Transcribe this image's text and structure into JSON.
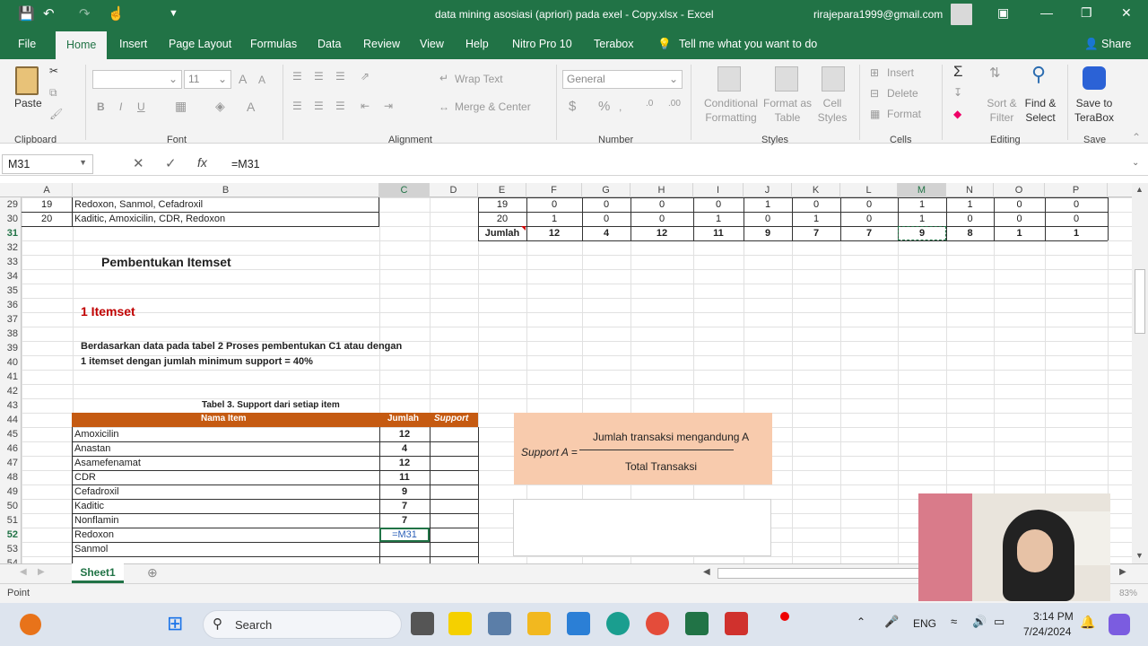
{
  "title_bar": {
    "document_title": "data mining asosiasi (apriori) pada exel - Copy.xlsx  -  Excel",
    "user_email": "rirajepara1999@gmail.com"
  },
  "ribbon_tabs": [
    "File",
    "Home",
    "Insert",
    "Page Layout",
    "Formulas",
    "Data",
    "Review",
    "View",
    "Help",
    "Nitro Pro 10",
    "Terabox"
  ],
  "tell_me": "Tell me what you want to do",
  "share": "Share",
  "ribbon": {
    "paste": "Paste",
    "clipboard": "Clipboard",
    "font_size": "11",
    "font": "Font",
    "wrap_text": "Wrap Text",
    "merge_center": "Merge & Center",
    "alignment": "Alignment",
    "number_format": "General",
    "number": "Number",
    "conditional_formatting": "Conditional Formatting",
    "format_as_table": "Format as Table",
    "cell_styles": "Cell Styles",
    "styles": "Styles",
    "insert": "Insert",
    "delete": "Delete",
    "format": "Format",
    "cells": "Cells",
    "sort_filter": "Sort & Filter",
    "find_select": "Find & Select",
    "editing": "Editing",
    "save_terabox": "Save to TeraBox",
    "save": "Save"
  },
  "formula_bar": {
    "name_box": "M31",
    "formula": "=M31"
  },
  "columns": [
    "A",
    "B",
    "C",
    "D",
    "E",
    "F",
    "G",
    "H",
    "I",
    "J",
    "K",
    "L",
    "M",
    "N",
    "O",
    "P"
  ],
  "rows": [
    "29",
    "30",
    "31",
    "32",
    "33",
    "34",
    "35",
    "36",
    "37",
    "38",
    "39",
    "40",
    "41",
    "42",
    "43",
    "44",
    "45",
    "46",
    "47",
    "48",
    "49",
    "50",
    "51",
    "52",
    "53",
    "54"
  ],
  "data_rows": [
    {
      "a": "19",
      "b": "Redoxon, Sanmol, Cefadroxil"
    },
    {
      "a": "20",
      "b": "Kaditic, Amoxicilin, CDR, Redoxon"
    }
  ],
  "right_table": {
    "row29": [
      "19",
      "0",
      "0",
      "0",
      "0",
      "1",
      "0",
      "0",
      "1",
      "1",
      "0",
      "0"
    ],
    "row30": [
      "20",
      "1",
      "0",
      "0",
      "1",
      "0",
      "1",
      "0",
      "1",
      "0",
      "0",
      "0"
    ],
    "row31": [
      "Jumlah",
      "12",
      "4",
      "12",
      "11",
      "9",
      "7",
      "7",
      "9",
      "8",
      "1",
      "1"
    ]
  },
  "heading_itemset": "Pembentukan Itemset",
  "heading_1itemset": "1 Itemset",
  "para_line1": "Berdasarkan data pada tabel 2 Proses pembentukan C1 atau dengan",
  "para_line2": "1 itemset dengan jumlah minimum support = 40%",
  "table3": {
    "caption": "Tabel 3. Support dari setiap item",
    "headers": [
      "Nama Item",
      "Jumlah",
      "Support"
    ],
    "rows": [
      {
        "name": "Amoxicilin",
        "count": "12"
      },
      {
        "name": "Anastan",
        "count": "4"
      },
      {
        "name": "Asamefenamat",
        "count": "12"
      },
      {
        "name": "CDR",
        "count": "11"
      },
      {
        "name": "Cefadroxil",
        "count": "9"
      },
      {
        "name": "Kaditic",
        "count": "7"
      },
      {
        "name": "Nonflamin",
        "count": "7"
      },
      {
        "name": "Redoxon",
        "count": "=M31"
      },
      {
        "name": "Sanmol",
        "count": ""
      }
    ]
  },
  "formula_box": {
    "lhs": "Support A =",
    "numerator": "Jumlah transaksi mengandung A",
    "denominator": "Total Transaksi"
  },
  "sheet_tab": "Sheet1",
  "status": "Point",
  "zoom": "83%",
  "taskbar": {
    "search": "Search",
    "lang": "ENG",
    "time": "3:14 PM",
    "date": "7/24/2024"
  },
  "colors": {
    "excel_green": "#217346",
    "table_header": "#c55a11",
    "formula_bg": "#f8cbad",
    "heading_red": "#c00000"
  }
}
